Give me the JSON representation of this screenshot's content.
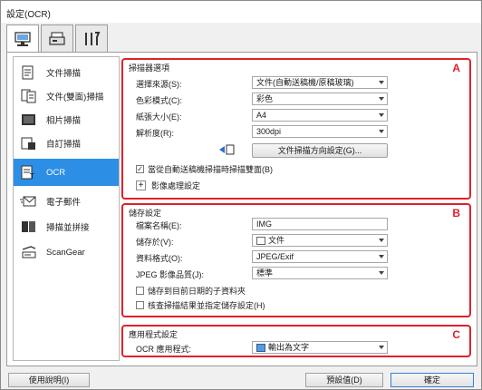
{
  "window": {
    "title": "設定(OCR)"
  },
  "top_tabs": [
    {
      "icon": "scan-from-computer-icon"
    },
    {
      "icon": "scan-from-panel-icon"
    },
    {
      "icon": "general-settings-icon"
    }
  ],
  "sidebar": {
    "items": [
      {
        "label": "文件掃描",
        "icon": "document-scan-icon"
      },
      {
        "label": "文件(雙面)掃描",
        "icon": "duplex-scan-icon"
      },
      {
        "label": "相片掃描",
        "icon": "photo-scan-icon"
      },
      {
        "label": "自訂掃描",
        "icon": "custom-scan-icon"
      },
      {
        "label": "OCR",
        "icon": "ocr-icon",
        "active": true
      },
      {
        "label": "電子郵件",
        "icon": "email-icon"
      },
      {
        "label": "掃描並拼接",
        "icon": "stitch-icon"
      },
      {
        "label": "ScanGear",
        "icon": "scangear-icon"
      }
    ]
  },
  "scanner_options": {
    "title": "掃描器選項",
    "badge": "A",
    "select_source_label": "選擇來源(S):",
    "select_source_value": "文件(自動送稿機/原稿玻璃)",
    "color_mode_label": "色彩模式(C):",
    "color_mode_value": "彩色",
    "paper_size_label": "紙張大小(E):",
    "paper_size_value": "A4",
    "resolution_label": "解析度(R):",
    "resolution_value": "300dpi",
    "orientation_button": "文件掃描方向設定(G)...",
    "duplex_checkbox": "當從自動送稿機掃描時掃描雙面(B)",
    "duplex_checked": true,
    "image_processing": "影像處理設定"
  },
  "save_settings": {
    "title": "儲存設定",
    "badge": "B",
    "file_name_label": "檔案名稱(E):",
    "file_name_value": "IMG",
    "save_in_label": "儲存於(V):",
    "save_in_value": "文件",
    "data_format_label": "資料格式(O):",
    "data_format_value": "JPEG/Exif",
    "jpeg_quality_label": "JPEG 影像品質(J):",
    "jpeg_quality_value": "標準",
    "subfolder_checkbox": "儲存到目前日期的子資料夾",
    "subfolder_checked": false,
    "check_results_checkbox": "核查掃描結果並指定儲存設定(H)",
    "check_results_checked": false
  },
  "app_settings": {
    "title": "應用程式設定",
    "badge": "C",
    "ocr_app_label": "OCR 應用程式:",
    "ocr_app_value": "輸出為文字"
  },
  "footer": {
    "help_button": "使用說明(I)",
    "defaults_button": "預設值(D)",
    "ok_button": "確定"
  }
}
